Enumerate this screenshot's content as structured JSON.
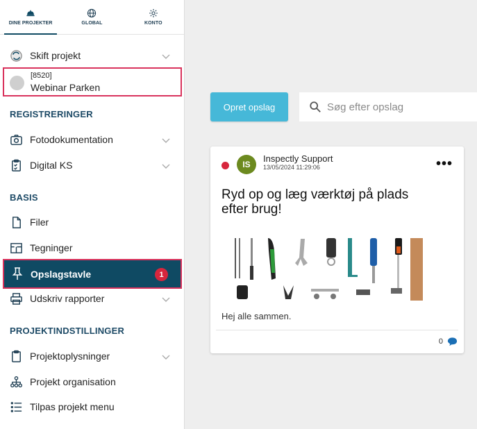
{
  "topnav": {
    "tabs": [
      {
        "label": "DINE PROJEKTER",
        "icon": "helmet-icon"
      },
      {
        "label": "GLOBAL",
        "icon": "globe-icon"
      },
      {
        "label": "KONTO",
        "icon": "gear-icon"
      }
    ]
  },
  "sidebar": {
    "switch_project": "Skift projekt",
    "project": {
      "code": "[8520]",
      "name": "Webinar Parken"
    },
    "section_registreringer": "REGISTRERINGER",
    "fotodokumentation": "Fotodokumentation",
    "digital_ks": "Digital KS",
    "section_basis": "BASIS",
    "filer": "Filer",
    "tegninger": "Tegninger",
    "opslagstavle": "Opslagstavle",
    "opslagstavle_badge": "1",
    "udskriv_rapporter": "Udskriv rapporter",
    "section_projektindstillinger": "PROJEKTINDSTILLINGER",
    "projektoplysninger": "Projektoplysninger",
    "projekt_organisation": "Projekt organisation",
    "tilpas_projekt_menu": "Tilpas projekt menu"
  },
  "main": {
    "create_button": "Opret opslag",
    "search_placeholder": "Søg efter opslag",
    "post": {
      "avatar_initials": "IS",
      "author": "Inspectly Support",
      "date": "13/05/2024 11:29:06",
      "more": "•••",
      "title": "Ryd op og læg værktøj på plads efter brug!",
      "body": "Hej alle sammen.",
      "comment_count": "0"
    }
  },
  "colors": {
    "accent": "#0f4a63",
    "highlight_border": "#d9325c",
    "button": "#46b8d8",
    "badge": "#d7263d",
    "avatar": "#6c8a1f"
  }
}
